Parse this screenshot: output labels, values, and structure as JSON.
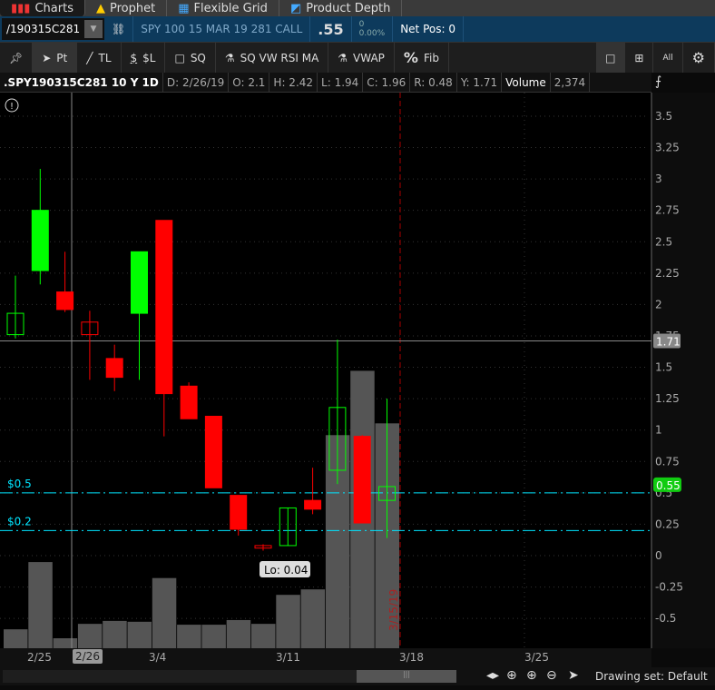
{
  "tabs": [
    {
      "label": "Charts",
      "icon": "bar-chart-icon"
    },
    {
      "label": "Prophet",
      "icon": "prophet-icon"
    },
    {
      "label": "Flexible Grid",
      "icon": "grid-icon"
    },
    {
      "label": "Product Depth",
      "icon": "depth-icon"
    }
  ],
  "symbol_bar": {
    "symbol": "/190315C281",
    "description": "SPY 100 15 MAR 19 281 CALL",
    "last": ".55",
    "change": "0",
    "change_pct": "0.00%",
    "net_pos": "Net Pos: 0"
  },
  "toolbar": [
    {
      "label": "",
      "icon": "pin-icon"
    },
    {
      "label": "Pt",
      "icon": "cursor-icon"
    },
    {
      "label": "TL",
      "icon": "trendline-icon"
    },
    {
      "label": "$L",
      "icon": "price-level-icon"
    },
    {
      "label": "SQ",
      "icon": "square-icon"
    },
    {
      "label": "SQ VW RSI MA",
      "icon": "studies-icon"
    },
    {
      "label": "VWAP",
      "icon": "flask-icon"
    },
    {
      "label": "Fib",
      "icon": "percent-icon"
    }
  ],
  "toolbar_right": {
    "all": "All"
  },
  "info": {
    "title": ".SPY190315C281 10 Y 1D",
    "date": "D: 2/26/19",
    "open": "O: 2.1",
    "high": "H: 2.42",
    "low": "L: 1.94",
    "close": "C: 1.96",
    "range": "R: 0.48",
    "y": "Y: 1.71",
    "volume_label": "Volume",
    "volume": "2,374"
  },
  "chart_data": {
    "type": "candlestick",
    "dates": [
      "2/22",
      "2/25",
      "2/26",
      "2/27",
      "2/28",
      "3/1",
      "3/4",
      "3/5",
      "3/6",
      "3/7",
      "3/8",
      "3/11",
      "3/12",
      "3/13",
      "3/14",
      "3/15"
    ],
    "open": [
      1.76,
      2.27,
      2.1,
      1.86,
      1.57,
      1.93,
      2.67,
      1.35,
      1.11,
      0.48,
      0.08,
      0.08,
      0.44,
      0.68,
      0.95,
      0.44
    ],
    "high": [
      2.23,
      3.08,
      2.42,
      1.95,
      1.68,
      2.42,
      2.67,
      1.38,
      1.11,
      0.48,
      0.09,
      0.38,
      0.7,
      1.72,
      0.96,
      1.25
    ],
    "low": [
      1.73,
      2.16,
      1.94,
      1.4,
      1.31,
      1.4,
      0.95,
      1.09,
      0.54,
      0.16,
      0.04,
      0.08,
      0.33,
      0.57,
      0.26,
      0.14
    ],
    "close": [
      1.93,
      2.75,
      1.96,
      1.76,
      1.42,
      2.42,
      1.29,
      1.09,
      0.54,
      0.21,
      0.06,
      0.38,
      0.37,
      1.18,
      0.26,
      0.55
    ],
    "volume": [
      4500,
      20500,
      2374,
      5800,
      6500,
      6300,
      16700,
      5600,
      5600,
      6700,
      5800,
      12700,
      14000,
      50700,
      66000,
      53500
    ],
    "yticks": [
      "3.5",
      "3.25",
      "3",
      "2.75",
      "2.5",
      "2.25",
      "2",
      "1.75",
      "1.5",
      "1.25",
      "1",
      "0.75",
      "0.5",
      "0.25",
      "0",
      "-0.25",
      "-0.5"
    ],
    "ylim": [
      -0.7,
      3.6
    ],
    "xticks": [
      "2/25",
      "3/4",
      "3/11",
      "3/18",
      "3/25"
    ],
    "crosshair_date": "2/26",
    "crosshair_price": "1.71",
    "last_price": "0.55",
    "levels": [
      {
        "label": "$0.5",
        "value": 0.5
      },
      {
        "label": "$0.2",
        "value": 0.2
      }
    ],
    "low_label": "Lo: 0.04",
    "expiry_label": "3/15/19"
  },
  "bottom": {
    "drawing_set": "Drawing set: Default"
  },
  "colors": {
    "up": "#00ff00",
    "down": "#ff0000",
    "level": "#00e5ff",
    "volume": "#555555"
  }
}
